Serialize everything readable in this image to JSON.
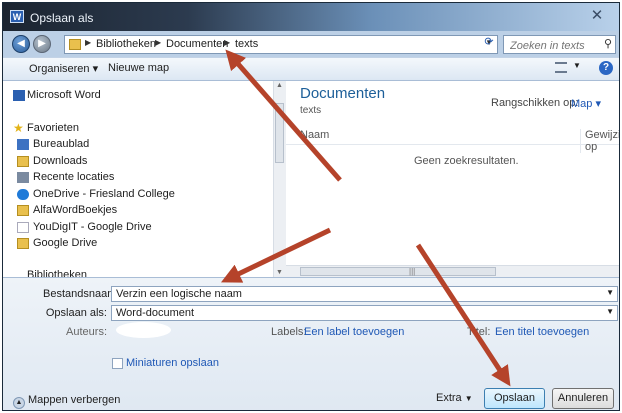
{
  "window": {
    "title": "Opslaan als",
    "close_glyph": "✕"
  },
  "address": {
    "crumbs": [
      "Bibliotheken",
      "Documenten",
      "texts"
    ],
    "search_placeholder": "Zoeken in texts"
  },
  "toolbar": {
    "organize": "Organiseren ▾",
    "new_folder": "Nieuwe map"
  },
  "nav": {
    "top_item": "Microsoft Word",
    "favorites_header": "Favorieten",
    "favorites": [
      "Bureaublad",
      "Downloads",
      "Recente locaties",
      "OneDrive - Friesland College",
      "AlfaWordBoekjes",
      "YouDigIT - Google Drive",
      "Google Drive"
    ],
    "libraries_header": "Bibliotheken"
  },
  "content": {
    "title": "Documenten",
    "subtitle": "texts",
    "sort_label": "Rangschikken op:",
    "sort_value": "Map ▾",
    "col_name": "Naam",
    "col_modified": "Gewijzigd op",
    "empty": "Geen zoekresultaten."
  },
  "form": {
    "filename_label": "Bestandsnaam:",
    "filename_value": "Verzin een logische naam",
    "type_label": "Opslaan als:",
    "type_value": "Word-document",
    "authors_label": "Auteurs:",
    "labels_label": "Labels:",
    "labels_link": "Een label toevoegen",
    "title_label": "Titel:",
    "title_link": "Een titel toevoegen",
    "thumbnails": "Miniaturen opslaan",
    "hide_folders": "Mappen verbergen",
    "extra": "Extra",
    "save": "Opslaan",
    "cancel": "Annuleren"
  },
  "colors": {
    "annotation_arrow": "#b5432a",
    "heading_blue": "#1d5f99",
    "link_blue": "#1f58b5"
  }
}
